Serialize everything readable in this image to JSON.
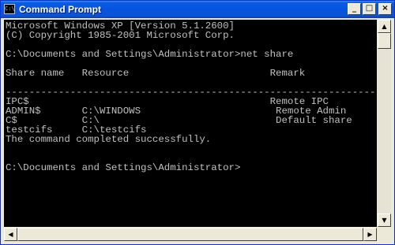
{
  "window": {
    "title": "Command Prompt",
    "icon": "cmd-icon",
    "minimize_glyph": "_",
    "maximize_glyph": "□",
    "close_glyph": "×"
  },
  "console": {
    "text": "Microsoft Windows XP [Version 5.1.2600]\n(C) Copyright 1985-2001 Microsoft Corp.\n\nC:\\Documents and Settings\\Administrator>net share\n\nShare name   Resource                        Remark\n\n-------------------------------------------------------------------------------\nIPC$                                         Remote IPC\nADMIN$       C:\\WINDOWS                       Remote Admin\nC$           C:\\                              Default share\ntestcifs     C:\\testcifs\nThe command completed successfully.\n\n\nC:\\Documents and Settings\\Administrator>"
  },
  "scrollbars": {
    "up_glyph": "▲",
    "down_glyph": "▼",
    "left_glyph": "◀",
    "right_glyph": "▶"
  }
}
